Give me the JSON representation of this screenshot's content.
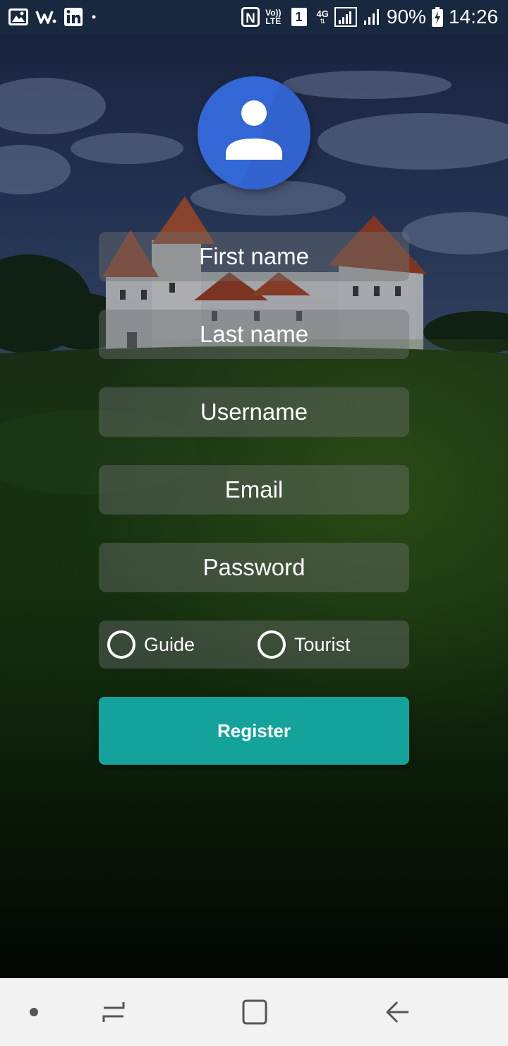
{
  "status_bar": {
    "left_icons": [
      "image-icon",
      "w-app-icon",
      "linkedin-icon",
      "dot-icon"
    ],
    "nfc_label": "N",
    "volte_top": "Vo))",
    "volte_bottom": "LTE",
    "sim_label": "1",
    "network_label": "4G",
    "battery_percent": "90%",
    "time": "14:26"
  },
  "form": {
    "avatar_icon": "person-icon",
    "avatar_color": "#3367d6",
    "first_name_placeholder": "First name",
    "last_name_placeholder": "Last name",
    "username_placeholder": "Username",
    "email_placeholder": "Email",
    "password_placeholder": "Password",
    "role_options": [
      "Guide",
      "Tourist"
    ],
    "register_label": "Register",
    "accent_color": "#14a39a"
  },
  "nav_bar": {
    "buttons": [
      "dot-icon",
      "recent-apps-icon",
      "home-icon",
      "back-icon"
    ]
  }
}
